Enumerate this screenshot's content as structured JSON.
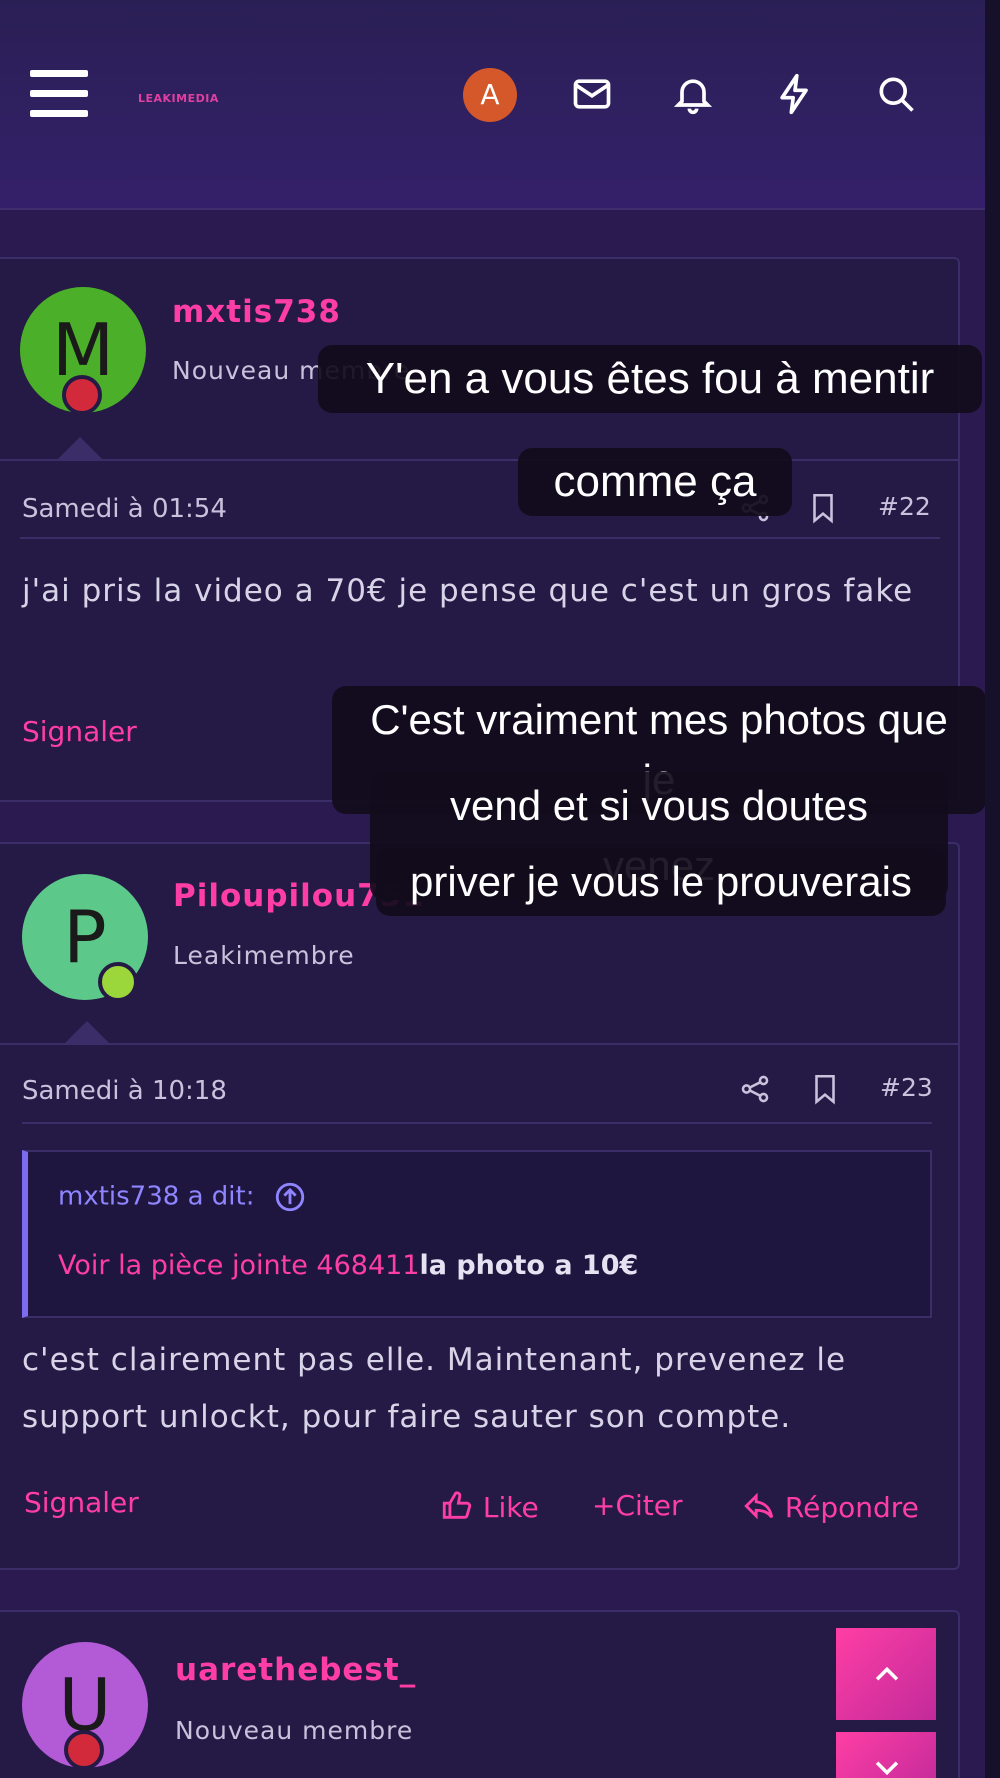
{
  "header": {
    "logo": "LEAKIMEDIA",
    "user_initial": "A"
  },
  "posts": [
    {
      "initial": "M",
      "username": "mxtis738",
      "role": "Nouveau membre",
      "date": "Samedi à 01:54",
      "number": "#22",
      "body": "j'ai pris la video a 70€ je pense que c'est un gros fake",
      "report": "Signaler"
    },
    {
      "initial": "P",
      "username": "Piloupilou751",
      "role": "Leakimembre",
      "date": "Samedi à 10:18",
      "number": "#23",
      "quote_author": "mxtis738 a dit:",
      "quote_link": "Voir la pièce jointe 468411",
      "quote_text": "la photo a 10€",
      "body": "c'est clairement pas elle. Maintenant, prevenez le support unlockt, pour faire sauter son compte.",
      "report": "Signaler",
      "like": "Like",
      "quote_action": "Citer",
      "reply": "Répondre"
    },
    {
      "initial": "U",
      "username": "uarethebest_",
      "role": "Nouveau membre"
    }
  ],
  "captions": {
    "first_line1": "Y'en a vous êtes fou à mentir",
    "first_line2": "comme ça",
    "second_line1": "C'est vraiment mes photos que je",
    "second_line2": "vend et si vous doutes venez",
    "second_line3": "priver je vous le prouverais"
  },
  "colors": {
    "accent": "#ff3ea5",
    "quote_author": "#8f85ff",
    "avatar_m": "#4caf2a",
    "avatar_p": "#5cc98a",
    "avatar_u": "#b35ad6",
    "header_avatar": "#d4582a"
  }
}
